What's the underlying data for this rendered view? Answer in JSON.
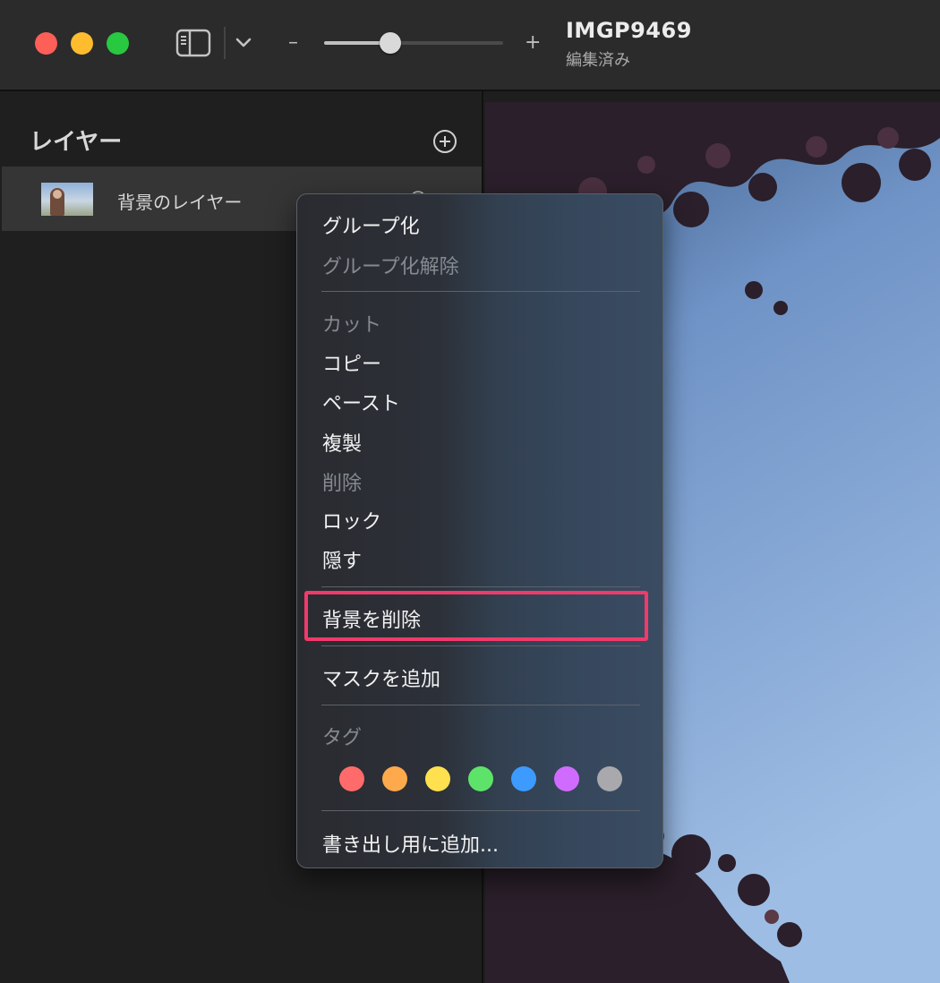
{
  "window": {
    "title": "IMGP9469",
    "subtitle": "編集済み"
  },
  "toolbar": {
    "zoom_minus": "–",
    "zoom_plus": "+",
    "zoom_level": 0.37
  },
  "sidebar": {
    "heading": "レイヤー",
    "layers": [
      {
        "name": "背景のレイヤー"
      }
    ]
  },
  "context_menu": {
    "items": [
      {
        "label": "グループ化",
        "enabled": true
      },
      {
        "label": "グループ化解除",
        "enabled": false
      },
      {
        "label": "カット",
        "enabled": false
      },
      {
        "label": "コピー",
        "enabled": true
      },
      {
        "label": "ペースト",
        "enabled": true
      },
      {
        "label": "複製",
        "enabled": true
      },
      {
        "label": "削除",
        "enabled": false
      },
      {
        "label": "ロック",
        "enabled": true
      },
      {
        "label": "隠す",
        "enabled": true
      },
      {
        "label": "背景を削除",
        "enabled": true,
        "highlighted": true
      },
      {
        "label": "マスクを追加",
        "enabled": true
      },
      {
        "label": "タグ",
        "enabled": false
      },
      {
        "label": "書き出し用に追加...",
        "enabled": true
      }
    ],
    "tags": [
      {
        "name": "red",
        "color": "#ff6b6b"
      },
      {
        "name": "orange",
        "color": "#ffa94d"
      },
      {
        "name": "yellow",
        "color": "#ffe04f"
      },
      {
        "name": "green",
        "color": "#5ee36a"
      },
      {
        "name": "blue",
        "color": "#3d9bff"
      },
      {
        "name": "purple",
        "color": "#d06bff"
      },
      {
        "name": "gray",
        "color": "#a9a9ad"
      }
    ],
    "highlight_color": "#f03a6b"
  }
}
